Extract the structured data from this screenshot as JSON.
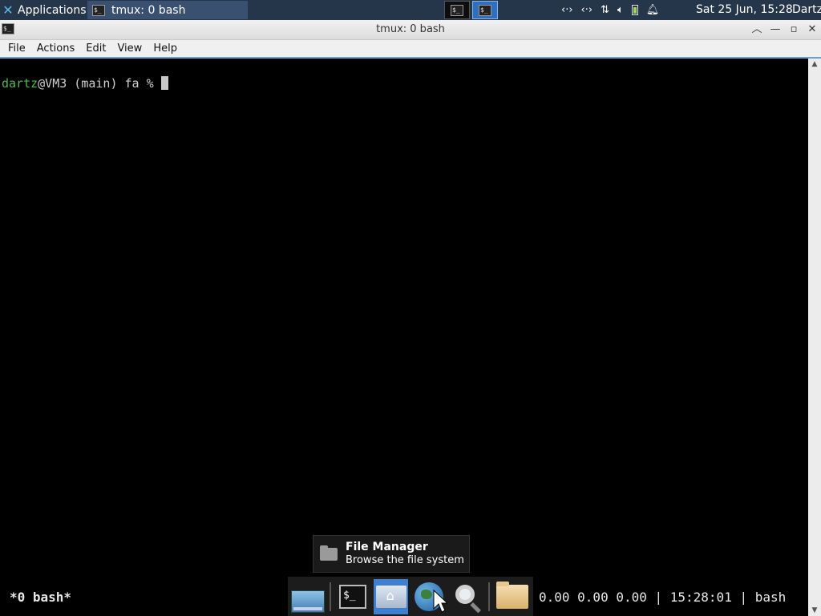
{
  "top_panel": {
    "applications_label": "Applications",
    "task_title": "tmux: 0 bash",
    "clock": "Sat 25 Jun, 15:28",
    "user": "Dartz"
  },
  "window": {
    "title": "tmux: 0 bash",
    "menu": [
      "File",
      "Actions",
      "Edit",
      "View",
      "Help"
    ]
  },
  "terminal": {
    "prompt_user": "dartz",
    "prompt_rest": "@VM3 (main) fa % "
  },
  "tmux_status": {
    "left": "*0 bash*",
    "right": "0.00 0.00 0.00 | 15:28:01 | bash"
  },
  "tooltip": {
    "title": "File Manager",
    "subtitle": "Browse the file system"
  },
  "icons": {
    "app_menu": "xfce-x-icon",
    "network": "network-icon",
    "transfer": "transfer-icon",
    "volume": "volume-icon",
    "battery": "battery-icon",
    "notifications": "bell-icon"
  },
  "colors": {
    "panel_bg": "#26364a",
    "prompt_user": "#4fb84f",
    "active_workspace": "#2f6fbf",
    "dock_active": "#3f7fcf"
  }
}
